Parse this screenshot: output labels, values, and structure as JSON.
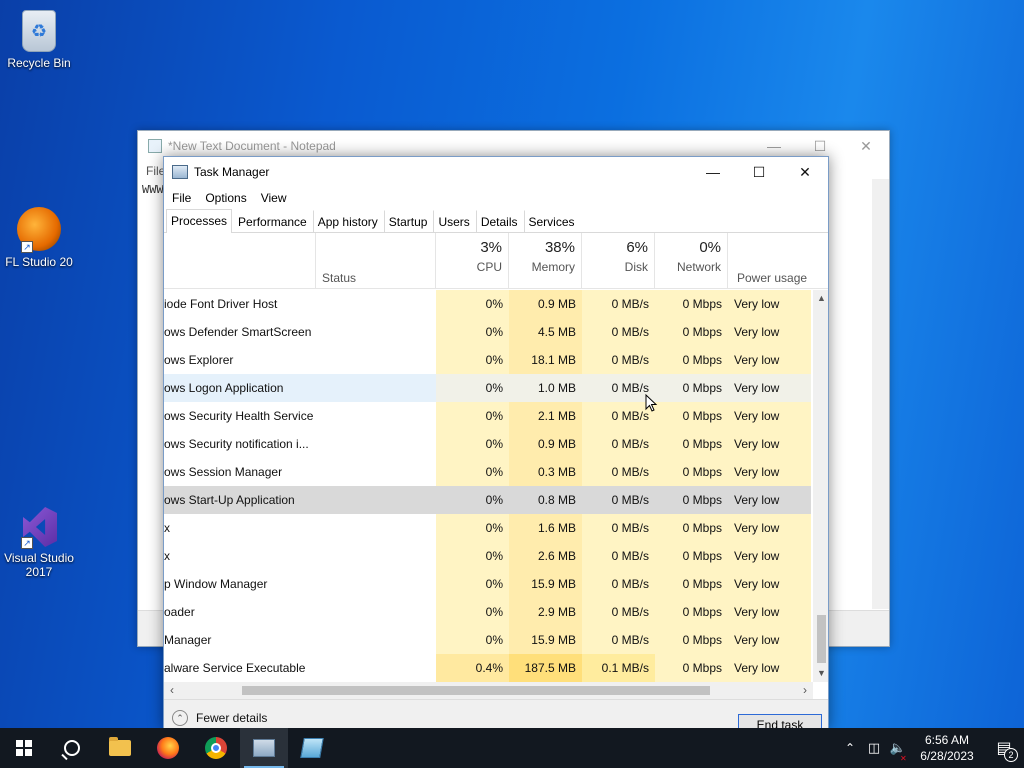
{
  "desktop": {
    "icons": [
      {
        "label": "Recycle Bin"
      },
      {
        "label": "FL Studio 20"
      },
      {
        "label_line1": "Visual Studio",
        "label_line2": "2017"
      }
    ]
  },
  "notepad": {
    "title": "*New Text Document - Notepad",
    "menu_first": "File",
    "text_fragment": "WWW"
  },
  "task_manager": {
    "title": "Task Manager",
    "menu": [
      "File",
      "Options",
      "View"
    ],
    "tabs": [
      "Processes",
      "Performance",
      "App history",
      "Startup",
      "Users",
      "Details",
      "Services"
    ],
    "header": {
      "status": "Status",
      "cpu_pct": "3%",
      "cpu_label": "CPU",
      "mem_pct": "38%",
      "mem_label": "Memory",
      "disk_pct": "6%",
      "disk_label": "Disk",
      "net_pct": "0%",
      "net_label": "Network",
      "power_label": "Power usage"
    },
    "rows": [
      {
        "name": "iode Font Driver Host",
        "cpu": "0%",
        "mem": "0.9 MB",
        "disk": "0 MB/s",
        "net": "0 Mbps",
        "power": "Very low"
      },
      {
        "name": "ows Defender SmartScreen",
        "cpu": "0%",
        "mem": "4.5 MB",
        "disk": "0 MB/s",
        "net": "0 Mbps",
        "power": "Very low"
      },
      {
        "name": "ows Explorer",
        "cpu": "0%",
        "mem": "18.1 MB",
        "disk": "0 MB/s",
        "net": "0 Mbps",
        "power": "Very low"
      },
      {
        "name": "ows Logon Application",
        "cpu": "0%",
        "mem": "1.0 MB",
        "disk": "0 MB/s",
        "net": "0 Mbps",
        "power": "Very low"
      },
      {
        "name": "ows Security Health Service",
        "cpu": "0%",
        "mem": "2.1 MB",
        "disk": "0 MB/s",
        "net": "0 Mbps",
        "power": "Very low"
      },
      {
        "name": "ows Security notification i...",
        "cpu": "0%",
        "mem": "0.9 MB",
        "disk": "0 MB/s",
        "net": "0 Mbps",
        "power": "Very low"
      },
      {
        "name": "ows Session Manager",
        "cpu": "0%",
        "mem": "0.3 MB",
        "disk": "0 MB/s",
        "net": "0 Mbps",
        "power": "Very low"
      },
      {
        "name": "ows Start-Up Application",
        "cpu": "0%",
        "mem": "0.8 MB",
        "disk": "0 MB/s",
        "net": "0 Mbps",
        "power": "Very low"
      },
      {
        "name": "x",
        "cpu": "0%",
        "mem": "1.6 MB",
        "disk": "0 MB/s",
        "net": "0 Mbps",
        "power": "Very low"
      },
      {
        "name": "x",
        "cpu": "0%",
        "mem": "2.6 MB",
        "disk": "0 MB/s",
        "net": "0 Mbps",
        "power": "Very low"
      },
      {
        "name": "p Window Manager",
        "cpu": "0%",
        "mem": "15.9 MB",
        "disk": "0 MB/s",
        "net": "0 Mbps",
        "power": "Very low"
      },
      {
        "name": "oader",
        "cpu": "0%",
        "mem": "2.9 MB",
        "disk": "0 MB/s",
        "net": "0 Mbps",
        "power": "Very low"
      },
      {
        "name": "Manager",
        "cpu": "0%",
        "mem": "15.9 MB",
        "disk": "0 MB/s",
        "net": "0 Mbps",
        "power": "Very low"
      },
      {
        "name": "alware Service Executable",
        "cpu": "0.4%",
        "mem": "187.5 MB",
        "disk": "0.1 MB/s",
        "net": "0 Mbps",
        "power": "Very low"
      }
    ],
    "fewer_details": "Fewer details",
    "end_task": "End task"
  },
  "taskbar": {
    "clock_time": "6:56 AM",
    "clock_date": "6/28/2023",
    "notification_count": "2"
  }
}
